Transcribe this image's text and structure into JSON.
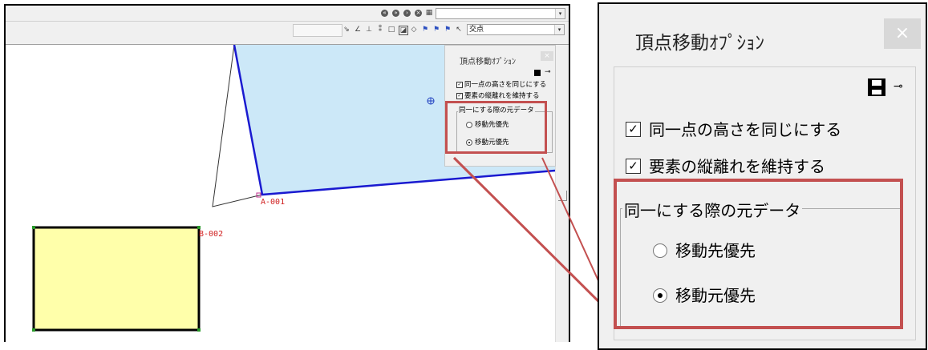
{
  "left_window": {
    "toolbar": {
      "combo_value": "",
      "snap_combo": "交点"
    },
    "canvas": {
      "label_a": "A-001",
      "label_b": "B-002"
    },
    "dialog": {
      "title": "頂点移動ｵﾌﾟｼｮﾝ",
      "check1": "同一点の高さを同じにする",
      "check2": "要素の縦離れを維持する",
      "group_title": "同一にする際の元データ",
      "radio1": "移動先優先",
      "radio2": "移動元優先"
    }
  },
  "zoom_dialog": {
    "title": "頂点移動ｵﾌﾟｼｮﾝ",
    "close": "×",
    "check1": "同一点の高さを同じにする",
    "check1_checked": true,
    "check2": "要素の縦離れを維持する",
    "check2_checked": true,
    "group_title": "同一にする際の元データ",
    "radio1": "移動先優先",
    "radio2": "移動元優先",
    "selected_radio": "移動元優先"
  },
  "colors": {
    "highlight": "#c35050",
    "polygon_fill": "#cce8f8",
    "polygon_edge": "#1a1ad0",
    "rect_fill": "#ffffaa",
    "label_red": "#d02020"
  }
}
